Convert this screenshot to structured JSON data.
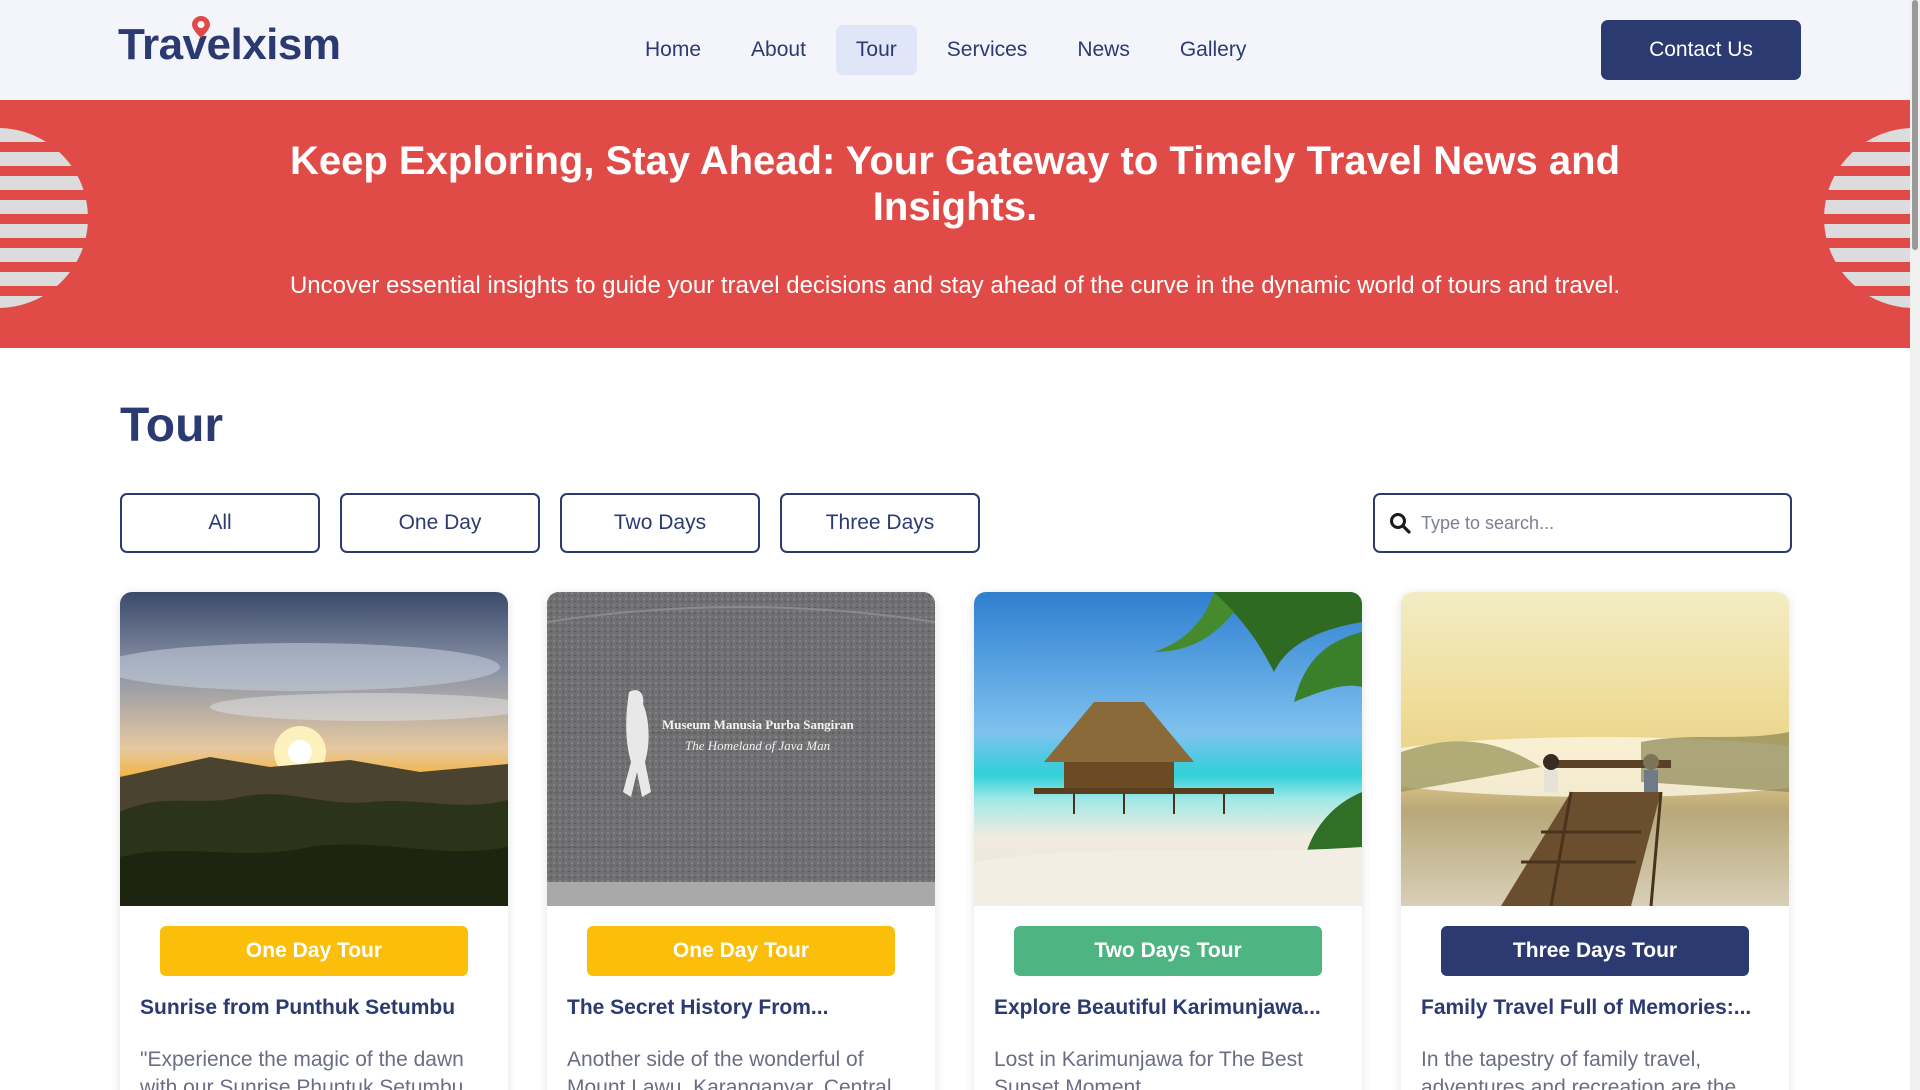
{
  "header": {
    "logo_text": "Travelxism",
    "nav": [
      {
        "label": "Home",
        "active": false
      },
      {
        "label": "About",
        "active": false
      },
      {
        "label": "Tour",
        "active": true
      },
      {
        "label": "Services",
        "active": false
      },
      {
        "label": "News",
        "active": false
      },
      {
        "label": "Gallery",
        "active": false
      }
    ],
    "contact_label": "Contact Us"
  },
  "banner": {
    "title": "Keep Exploring, Stay Ahead: Your Gateway to Timely Travel News and Insights.",
    "subtitle": "Uncover essential insights to guide your travel decisions and stay ahead of the curve in the dynamic world of tours and travel."
  },
  "section": {
    "title": "Tour",
    "filters": [
      "All",
      "One Day",
      "Two Days",
      "Three Days"
    ],
    "search_placeholder": "Type to search..."
  },
  "cards": [
    {
      "badge": "One Day Tour",
      "badge_color": "#fbbf0b",
      "title": "Sunrise from Punthuk Setumbu",
      "desc": "\"Experience the magic of the dawn with our Sunrise Phuntuk Setumbu"
    },
    {
      "badge": "One Day Tour",
      "badge_color": "#fbbf0b",
      "title": "The Secret History From...",
      "desc": "Another side of the wonderful of Mount Lawu, Karanganyar, Central",
      "image_text": [
        "Museum Manusia Purba Sangiran",
        "The Homeland of Java Man"
      ]
    },
    {
      "badge": "Two Days Tour",
      "badge_color": "#4db482",
      "title": "Explore Beautiful Karimunjawa...",
      "desc": "Lost in Karimunjawa for The Best Sunset Moment"
    },
    {
      "badge": "Three Days Tour",
      "badge_color": "#2c3a72",
      "title": "Family Travel Full of Memories:...",
      "desc": "In the tapestry of family travel, adventures and recreation are the"
    }
  ],
  "colors": {
    "primary": "#2c3a72",
    "banner": "#e04b48",
    "yellow": "#fbbf0b",
    "green": "#4db482"
  }
}
